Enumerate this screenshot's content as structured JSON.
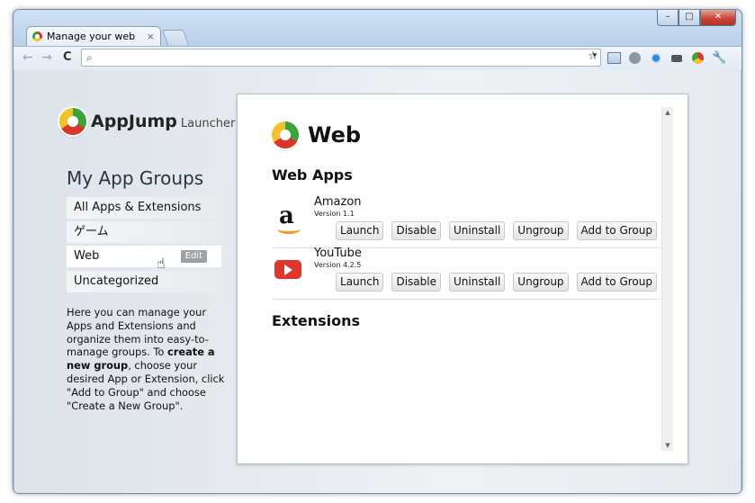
{
  "window": {
    "controls": {
      "minimize": "–",
      "maximize": "□",
      "close": "✕"
    }
  },
  "browser": {
    "tab_title": "Manage your web apps",
    "tab_close": "×",
    "nav": {
      "back": "←",
      "forward": "→",
      "reload": "C"
    },
    "omnibox": {
      "value": "",
      "search_icon": "⌕",
      "dropdown": "▾"
    },
    "toolbar_icons": [
      "star-icon",
      "page-icon",
      "extension-icon",
      "gear-extension-icon",
      "camera-icon",
      "chrome-icon",
      "wrench-icon"
    ]
  },
  "sidebar": {
    "logo_name": "AppJump",
    "logo_sub": "Launcher",
    "title": "My App Groups",
    "groups": [
      {
        "label": "All Apps & Extensions"
      },
      {
        "label": "ゲーム"
      },
      {
        "label": "Web",
        "edit": "Edit"
      },
      {
        "label": "Uncategorized"
      }
    ],
    "help": {
      "p1": "Here you can manage your Apps and Extensions and organize them into easy-to-manage groups. To ",
      "b1": "create a new group",
      "p2": ", choose your desired App or Extension, click \"Add to Group\" and choose \"Create a New Group\"."
    }
  },
  "main": {
    "title": "Web",
    "apps_heading": "Web Apps",
    "extensions_heading": "Extensions",
    "apps": [
      {
        "name": "Amazon",
        "version": "Version 1.1",
        "icon": "amazon-icon"
      },
      {
        "name": "YouTube",
        "version": "Version 4.2.5",
        "icon": "youtube-icon"
      }
    ],
    "buttons": {
      "launch": "Launch",
      "disable": "Disable",
      "uninstall": "Uninstall",
      "ungroup": "Ungroup",
      "add": "Add to Group"
    },
    "scroll": {
      "up": "▲",
      "down": "▼"
    }
  }
}
